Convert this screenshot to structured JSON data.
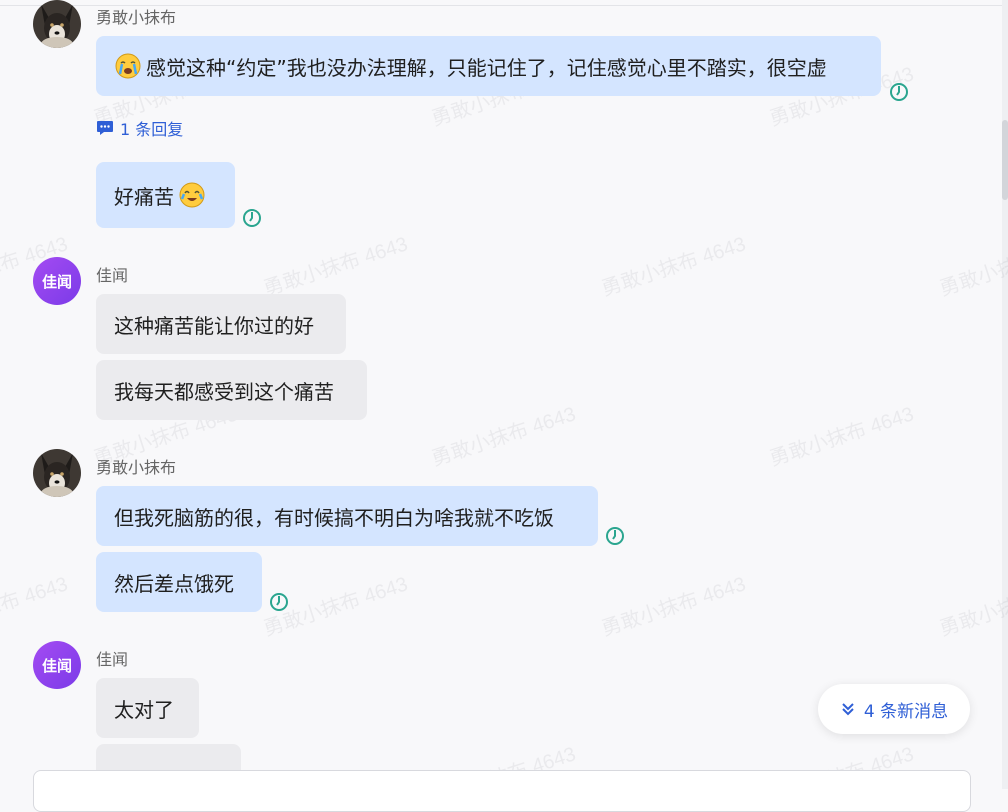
{
  "messages": [
    {
      "sender": "勇敢小抹布",
      "text": "感觉这种“约定”我也没办法理解，只能记住了，记住感觉心里不踏实，很空虚"
    },
    {
      "text": "好痛苦"
    },
    {
      "sender": "佳闻",
      "text": "这种痛苦能让你过的好"
    },
    {
      "text": "我每天都感受到这个痛苦"
    },
    {
      "sender": "勇敢小抹布",
      "text": "但我死脑筋的很，有时候搞不明白为啥我就不吃饭"
    },
    {
      "text": "然后差点饿死"
    },
    {
      "sender": "佳闻",
      "text": "太对了"
    },
    {
      "text": "…"
    }
  ],
  "avatar_jiawen_label": "佳闻",
  "thread_reply": {
    "label": "1 条回复",
    "icon": "chat-bubble-icon"
  },
  "new_messages_button": {
    "label": "4 条新消息",
    "icon": "double-chevron-down-icon"
  },
  "watermark_text": "勇敢小抹布 4643",
  "colors": {
    "my_bubble": "#d4e5ff",
    "their_bubble": "#ebebee",
    "accent": "#2f5fd6",
    "status_teal": "#2aa58f",
    "avatar_purple": "#8b40ee"
  }
}
